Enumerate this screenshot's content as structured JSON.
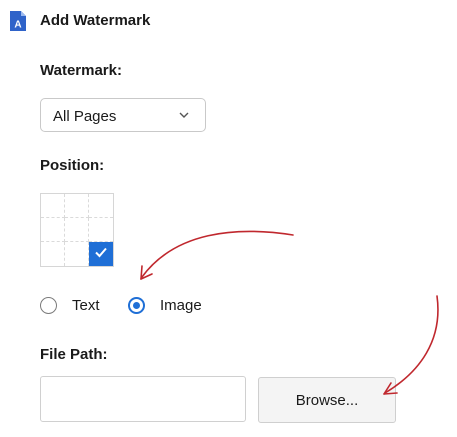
{
  "header": {
    "title": "Add Watermark",
    "app_icon": "document-a-icon"
  },
  "watermark": {
    "label": "Watermark:",
    "selected": "All Pages"
  },
  "position": {
    "label": "Position:",
    "selected_cell": "bottom-right"
  },
  "type": {
    "options": [
      {
        "label": "Text",
        "checked": false
      },
      {
        "label": "Image",
        "checked": true
      }
    ]
  },
  "file_path": {
    "label": "File Path:",
    "value": "",
    "browse_label": "Browse..."
  },
  "colors": {
    "accent": "#1f6fd6",
    "annotation": "#c0282e"
  }
}
